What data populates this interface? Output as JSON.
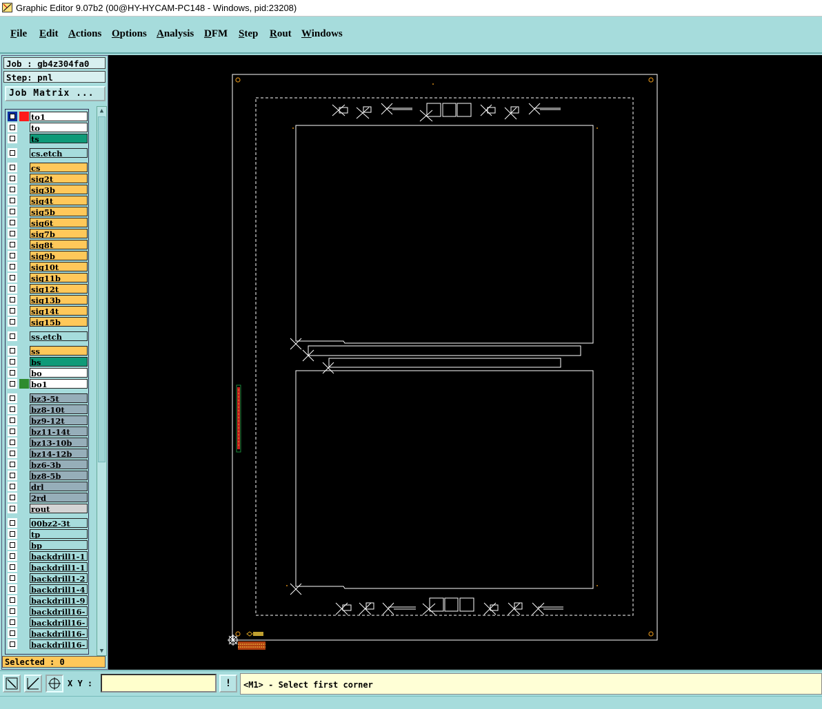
{
  "window": {
    "title": "Graphic Editor 9.07b2 (00@HY-HYCAM-PC148 - Windows, pid:23208)"
  },
  "menubar": {
    "items": [
      "File",
      "Edit",
      "Actions",
      "Options",
      "Analysis",
      "DFM",
      "Step",
      "Rout",
      "Windows"
    ]
  },
  "job": {
    "line": "Job : gb4z304fa0",
    "step_line": "Step: pnl"
  },
  "job_matrix_button": "Job Matrix ...",
  "layers": [
    {
      "name": "to1",
      "color": "#ffffff",
      "swatch": "#ff1a1a",
      "selected": true
    },
    {
      "name": "to",
      "color": "#ffffff"
    },
    {
      "name": "ts",
      "color": "#0f9a78"
    },
    {
      "name": "cs.etch",
      "color": "#a6dcdc",
      "gap": true
    },
    {
      "name": "cs",
      "color": "#ffc85a",
      "gap": true
    },
    {
      "name": "sig2t",
      "color": "#ffc85a"
    },
    {
      "name": "sig3b",
      "color": "#ffc85a"
    },
    {
      "name": "sig4t",
      "color": "#ffc85a"
    },
    {
      "name": "sig5b",
      "color": "#ffc85a"
    },
    {
      "name": "sig6t",
      "color": "#ffc85a"
    },
    {
      "name": "sig7b",
      "color": "#ffc85a"
    },
    {
      "name": "sig8t",
      "color": "#ffc85a"
    },
    {
      "name": "sig9b",
      "color": "#ffc85a"
    },
    {
      "name": "sig10t",
      "color": "#ffc85a"
    },
    {
      "name": "sig11b",
      "color": "#ffc85a"
    },
    {
      "name": "sig12t",
      "color": "#ffc85a"
    },
    {
      "name": "sig13b",
      "color": "#ffc85a"
    },
    {
      "name": "sig14t",
      "color": "#ffc85a"
    },
    {
      "name": "sig15b",
      "color": "#ffc85a"
    },
    {
      "name": "ss.etch",
      "color": "#a6dcdc",
      "gap": true
    },
    {
      "name": "ss",
      "color": "#ffc85a",
      "gap": true
    },
    {
      "name": "bs",
      "color": "#0f9a78"
    },
    {
      "name": "bo",
      "color": "#ffffff"
    },
    {
      "name": "bo1",
      "color": "#ffffff",
      "swatch": "#2e8b2e"
    },
    {
      "name": "bz3-5t",
      "color": "#96aeb9",
      "gap": true
    },
    {
      "name": "bz8-10t",
      "color": "#96aeb9"
    },
    {
      "name": "bz9-12t",
      "color": "#96aeb9"
    },
    {
      "name": "bz11-14t",
      "color": "#96aeb9"
    },
    {
      "name": "bz13-10b",
      "color": "#96aeb9"
    },
    {
      "name": "bz14-12b",
      "color": "#96aeb9"
    },
    {
      "name": "bz6-3b",
      "color": "#96aeb9"
    },
    {
      "name": "bz8-5b",
      "color": "#96aeb9"
    },
    {
      "name": "drl",
      "color": "#96aeb9"
    },
    {
      "name": "2rd",
      "color": "#96aeb9"
    },
    {
      "name": "rout",
      "color": "#d4d4d4"
    },
    {
      "name": "00bz2-3t",
      "color": "#a6dcdc",
      "gap": true
    },
    {
      "name": "tp",
      "color": "#a6dcdc"
    },
    {
      "name": "bp",
      "color": "#a6dcdc"
    },
    {
      "name": "backdrill1-1",
      "color": "#a6dcdc"
    },
    {
      "name": "backdrill1-1",
      "color": "#a6dcdc"
    },
    {
      "name": "backdrill1-2",
      "color": "#a6dcdc"
    },
    {
      "name": "backdrill1-4",
      "color": "#a6dcdc"
    },
    {
      "name": "backdrill1-9",
      "color": "#a6dcdc"
    },
    {
      "name": "backdrill16-",
      "color": "#a6dcdc"
    },
    {
      "name": "backdrill16-",
      "color": "#a6dcdc"
    },
    {
      "name": "backdrill16-",
      "color": "#a6dcdc"
    },
    {
      "name": "backdrill16-",
      "color": "#a6dcdc"
    }
  ],
  "selected_status": "Selected : 0",
  "bottom": {
    "xy_label": "X Y :",
    "xy_value": "",
    "prompt": "<M1> - Select first corner",
    "info_button": "!"
  }
}
